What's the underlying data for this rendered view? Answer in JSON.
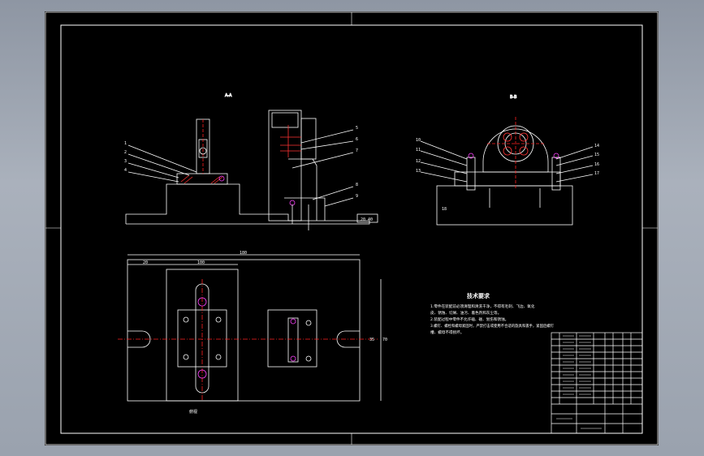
{
  "colors": {
    "background": "#000000",
    "line": "#ffffff",
    "center_line": "#ff2020",
    "hatch_red": "#ff3333",
    "bolt_magenta": "#ff40ff",
    "frame_outer": "#9aa2ae"
  },
  "views": {
    "front_label": "A-A",
    "side_label": "B-B",
    "top_label": "俯视"
  },
  "technical_requirements": {
    "heading": "技术要求",
    "lines": [
      "1.零件在装配前必须清理和清洗干净，不得有毛刺、飞边、氧化",
      "皮、锈蚀、切屑、油污、着色剂和灰尘等。",
      "2.装配过程中零件不允许磕、碰、划伤和锈蚀。",
      "3.螺钉、螺栓和螺母紧固时，严禁打击或使用不合适的旋具和扳手，紧固后螺钉",
      "槽、螺母不得损坏。"
    ]
  },
  "dimensions": {
    "d1": "20",
    "d2": "100",
    "d3": "180",
    "d4": "35",
    "d5": "70",
    "d6": "20",
    "d7": "40"
  },
  "balloons": [
    "1",
    "2",
    "3",
    "4",
    "5",
    "6",
    "7",
    "8",
    "9",
    "10",
    "11",
    "12",
    "13",
    "14",
    "15",
    "16",
    "17",
    "18"
  ]
}
